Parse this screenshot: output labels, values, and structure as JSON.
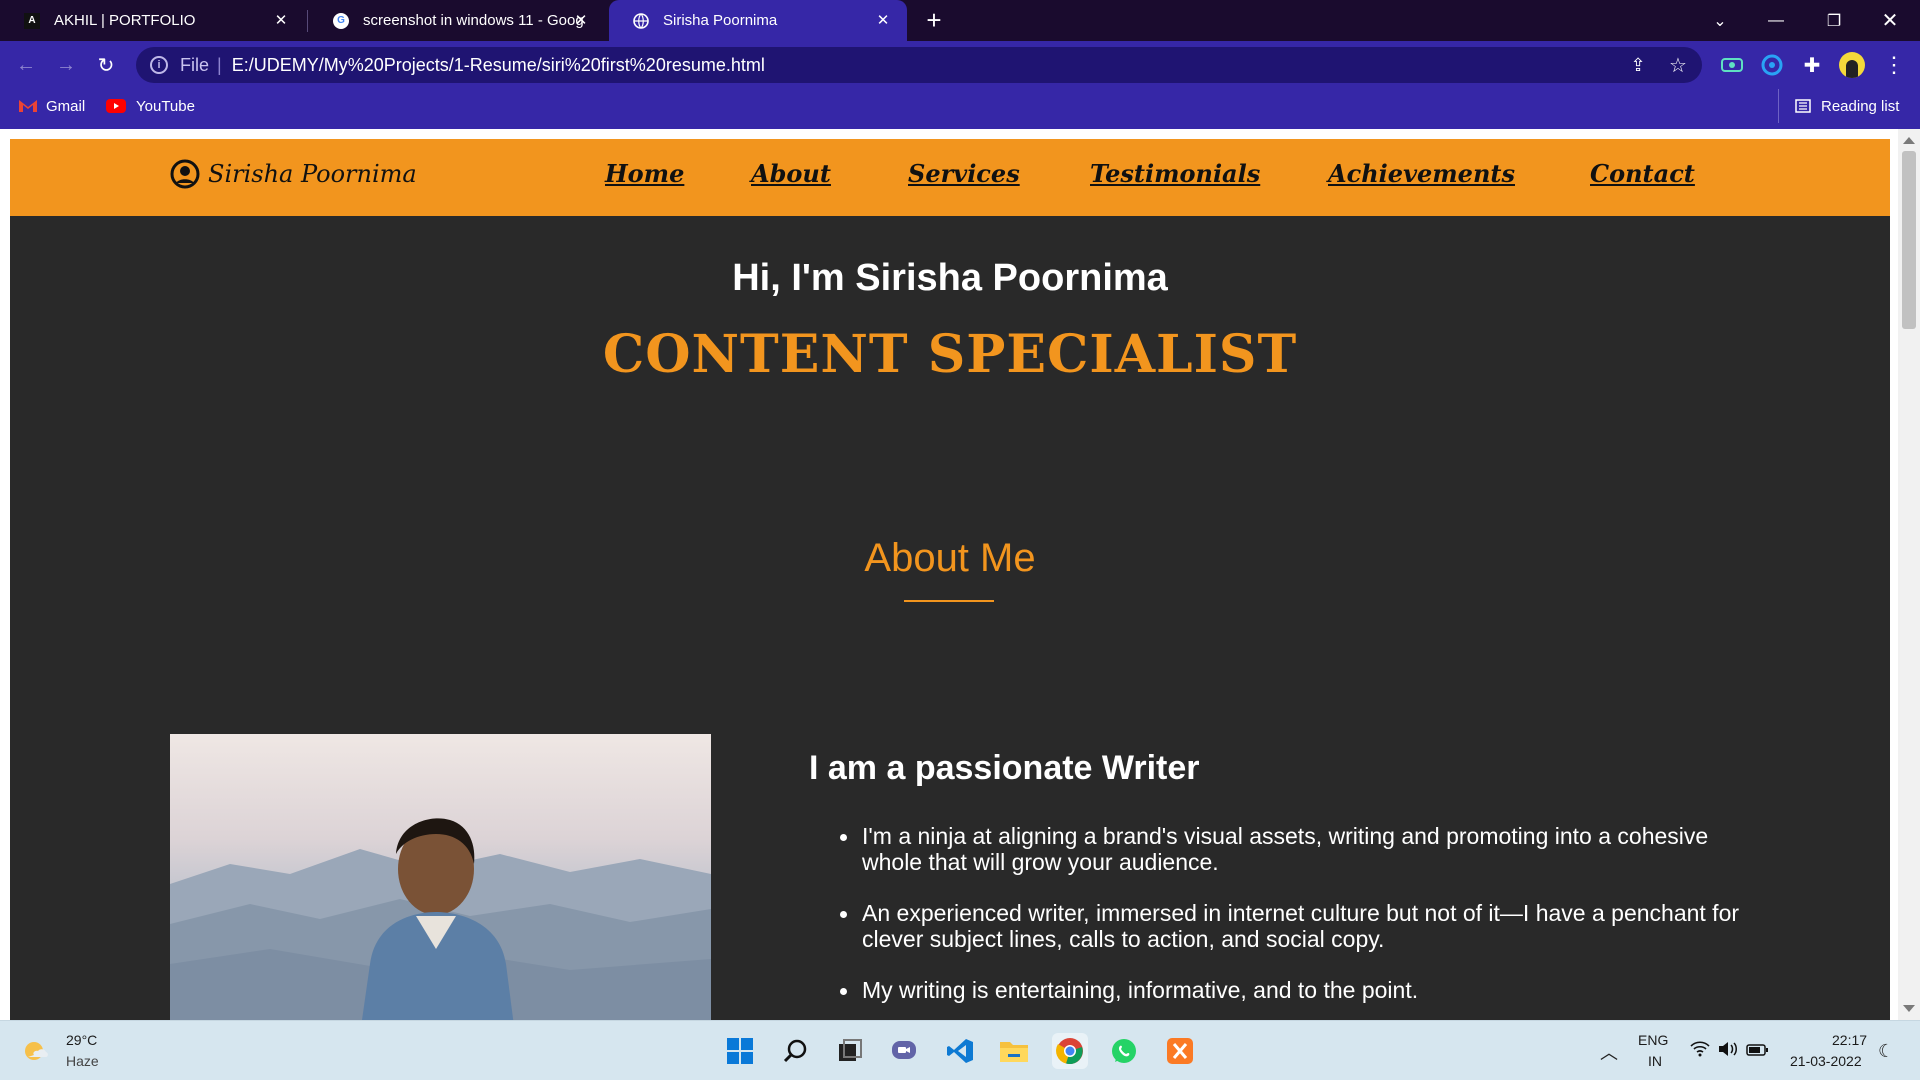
{
  "browser": {
    "tabs": [
      {
        "label": "AKHIL | PORTFOLIO",
        "favicon": "A"
      },
      {
        "label": "screenshot in windows 11 - Goog",
        "favicon": "G"
      },
      {
        "label": "Sirisha Poornima",
        "favicon": "globe"
      }
    ],
    "url_scheme": "File",
    "url": "E:/UDEMY/My%20Projects/1-Resume/siri%20first%20resume.html",
    "bookmarks": [
      "Gmail",
      "YouTube"
    ],
    "reading_list": "Reading list",
    "colors": {
      "frame": "#1a0b2e",
      "toolbar": "#3627a7",
      "omnibox": "#1f1472"
    }
  },
  "site": {
    "brand": "Sirisha Poornima",
    "nav": [
      "Home",
      "About",
      "Services",
      "Testimonials",
      "Achievements",
      "Contact"
    ],
    "hero_greeting": "Hi, I'm Sirisha Poornima",
    "hero_role": "CONTENT SPECIALIST",
    "about_title": "About Me",
    "writer_title": "I am a passionate Writer",
    "bullets": [
      "I'm a ninja at aligning a brand's visual assets, writing and promoting into a cohesive whole that will grow your audience.",
      "An experienced writer, immersed in internet culture but not of it—I have a penchant for clever subject lines, calls to action, and social copy.",
      "My writing is entertaining, informative, and to the point."
    ],
    "colors": {
      "accent": "#f2951e",
      "background": "#292929"
    }
  },
  "taskbar": {
    "weather_temp": "29°C",
    "weather_desc": "Haze",
    "lang_1": "ENG",
    "lang_2": "IN",
    "time": "22:17",
    "date": "21-03-2022"
  }
}
